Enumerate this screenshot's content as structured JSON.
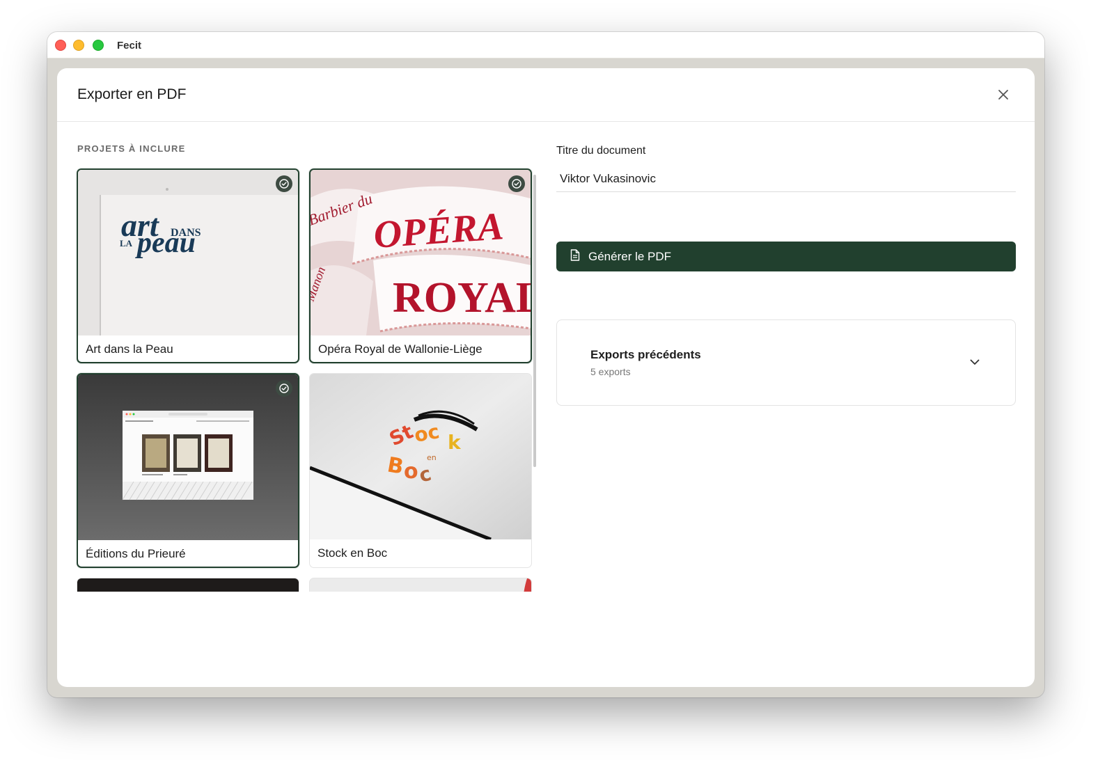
{
  "window": {
    "app_title": "Fecit"
  },
  "modal": {
    "title": "Exporter en PDF",
    "section_label": "PROJETS À INCLURE",
    "projects": [
      {
        "name": "Art dans la Peau",
        "selected": true,
        "logo": "art DANS LA peau"
      },
      {
        "name": "Opéra Royal de Wallonie-Liège",
        "selected": true,
        "logo": "OPÉRA ROYAL"
      },
      {
        "name": "Éditions du Prieuré",
        "selected": true
      },
      {
        "name": "Stock en Boc",
        "selected": false,
        "logo": "Stock en Boc"
      }
    ],
    "document_title_label": "Titre du document",
    "document_title_value": "Viktor Vukasinovic",
    "generate_label": "Générer le PDF",
    "exports": {
      "title": "Exports précédents",
      "count_label": "5 exports"
    }
  },
  "colors": {
    "accent": "#21402e",
    "check_badge": "#3d4b42"
  },
  "icons": [
    "close-icon",
    "check-circle-icon",
    "document-icon",
    "chevron-down-icon"
  ]
}
